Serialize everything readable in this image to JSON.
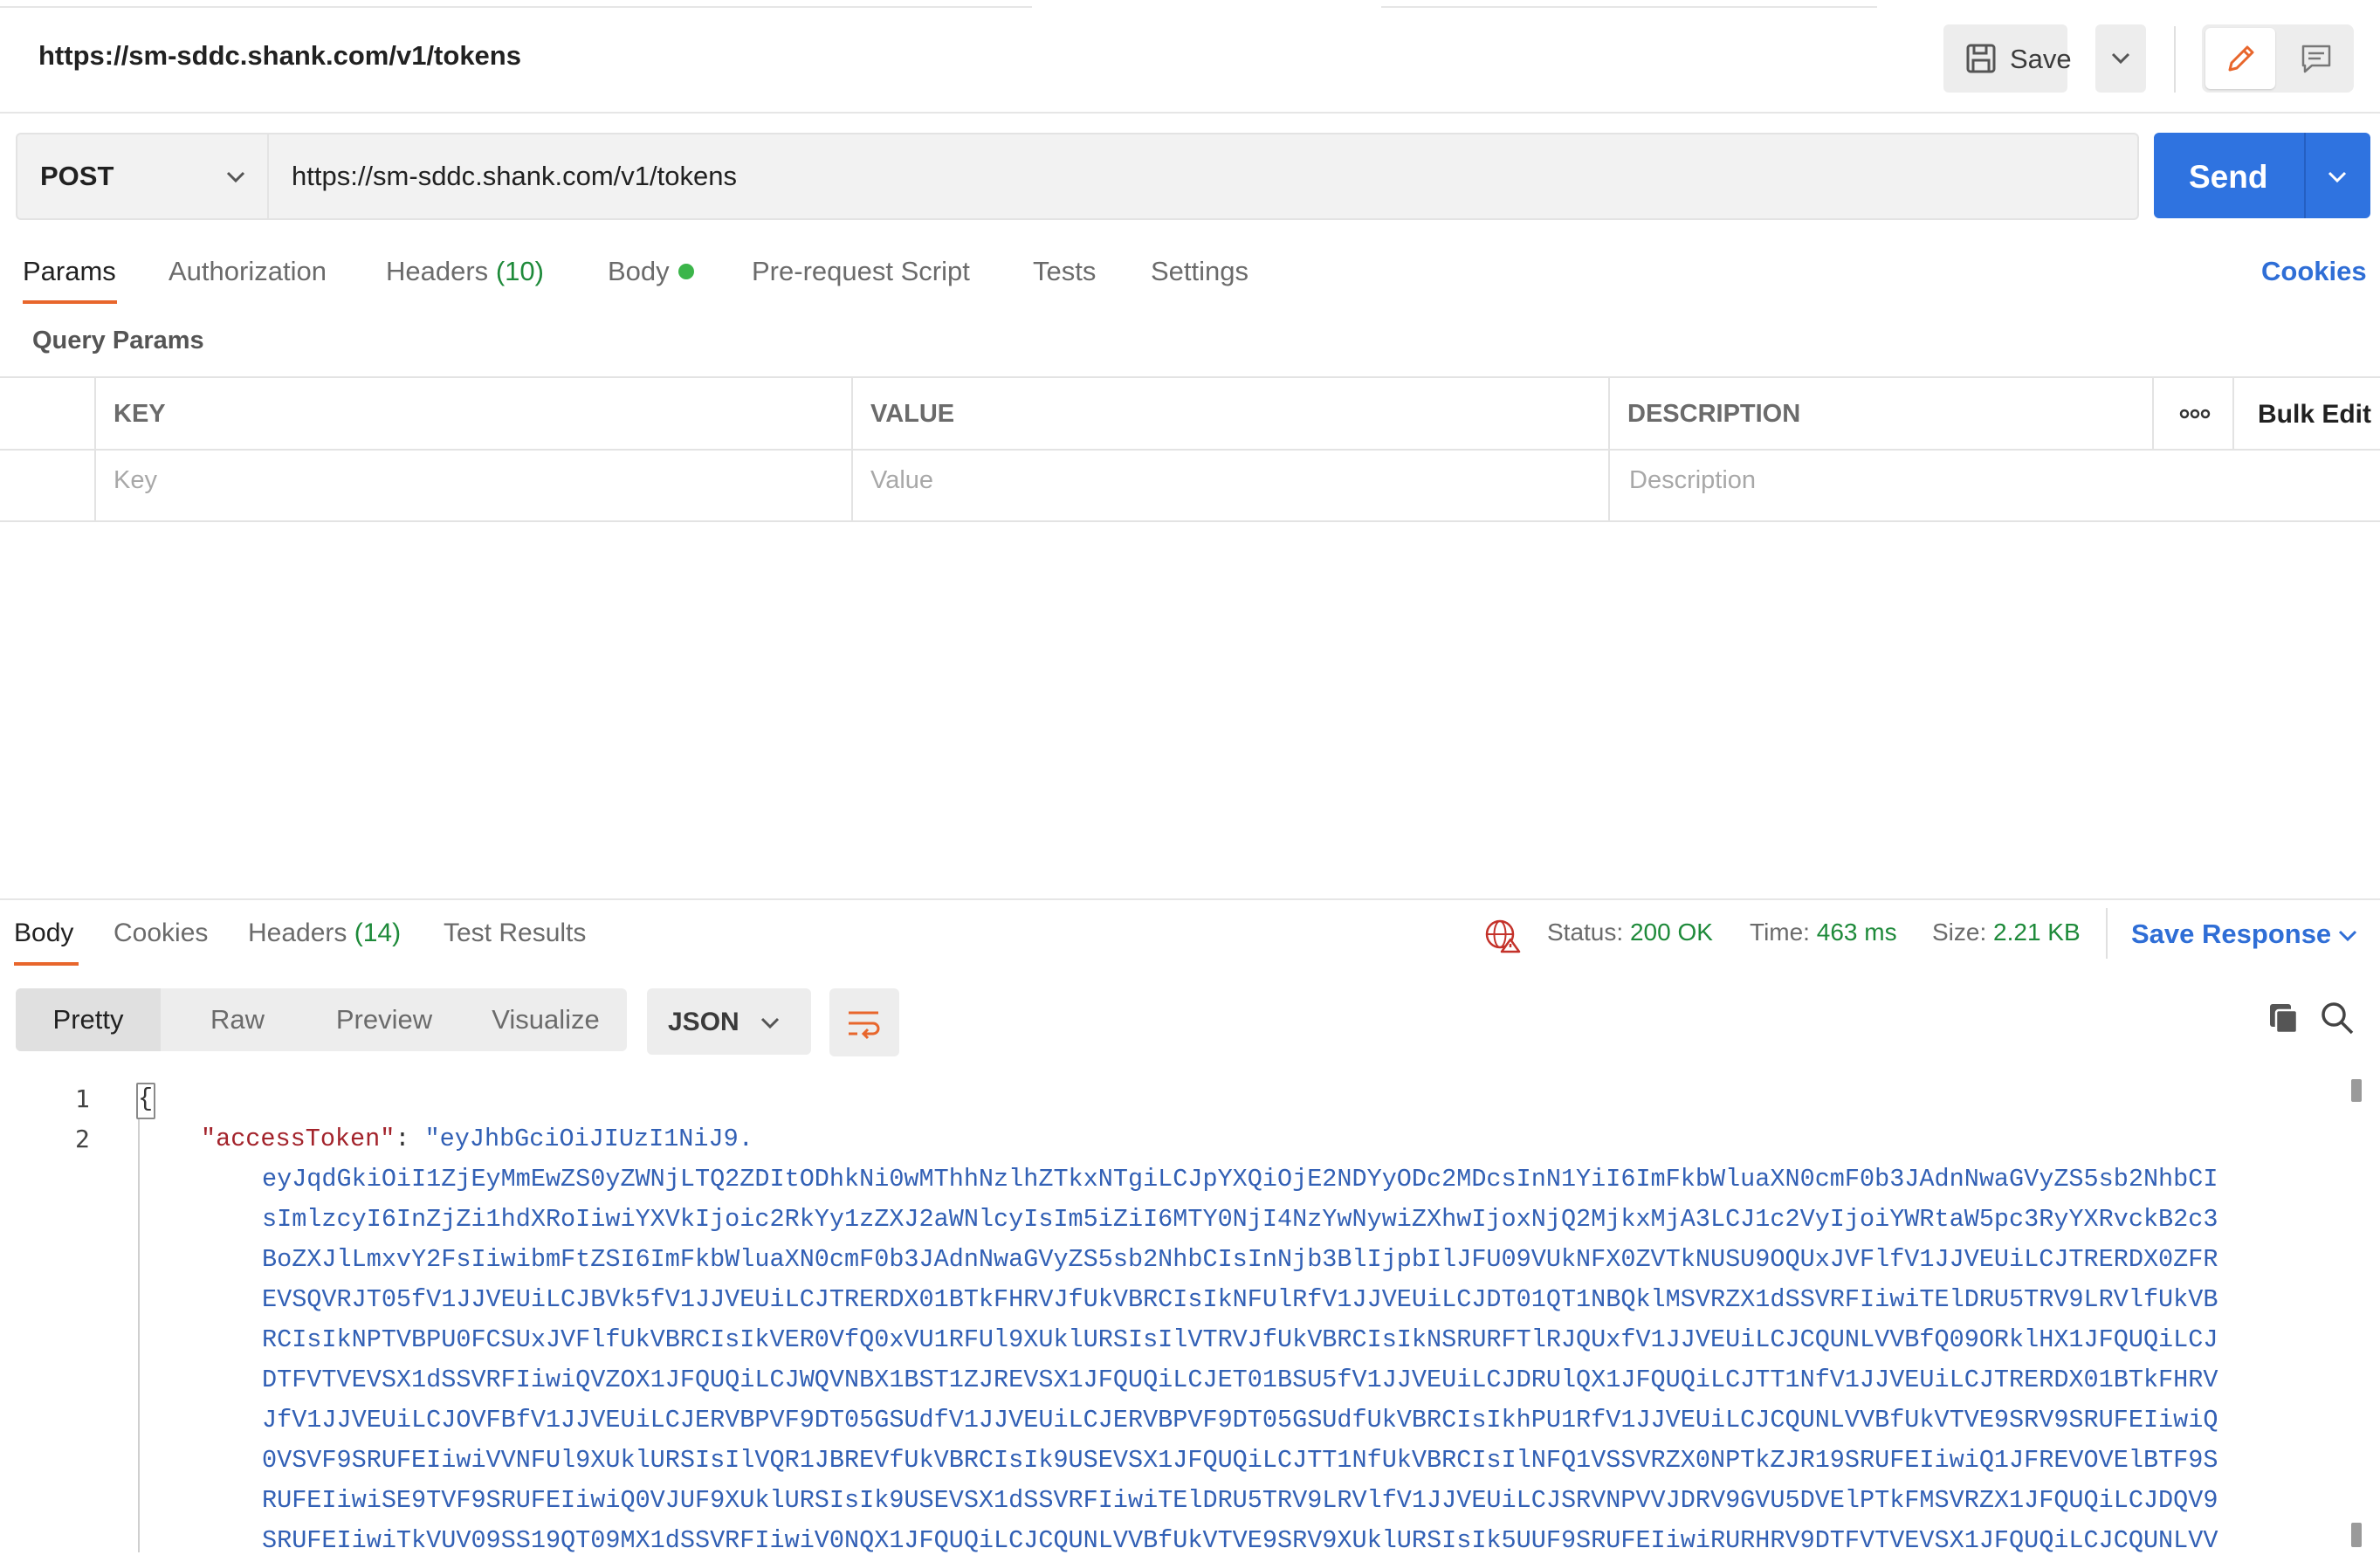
{
  "request": {
    "title": "https://sm-sddc.shank.com/v1/tokens",
    "save_label": "Save",
    "method": "POST",
    "url": "https://sm-sddc.shank.com/v1/tokens",
    "send_label": "Send"
  },
  "request_tabs": {
    "params": "Params",
    "authorization": "Authorization",
    "headers": "Headers",
    "headers_count": "(10)",
    "body": "Body",
    "prerequest": "Pre-request Script",
    "tests": "Tests",
    "settings": "Settings",
    "cookies": "Cookies"
  },
  "query_params": {
    "label": "Query Params",
    "columns": {
      "key": "KEY",
      "value": "VALUE",
      "description": "DESCRIPTION"
    },
    "bulk_edit": "Bulk Edit",
    "placeholders": {
      "key": "Key",
      "value": "Value",
      "description": "Description"
    }
  },
  "response": {
    "tabs": {
      "body": "Body",
      "cookies": "Cookies",
      "headers": "Headers",
      "headers_count": "(14)",
      "test_results": "Test Results"
    },
    "status_label": "Status:",
    "status_value": "200 OK",
    "time_label": "Time:",
    "time_value": "463 ms",
    "size_label": "Size:",
    "size_value": "2.21 KB",
    "save_response": "Save Response",
    "views": [
      "Pretty",
      "Raw",
      "Preview",
      "Visualize"
    ],
    "format": "JSON"
  },
  "editor": {
    "line_numbers": [
      "1",
      "2"
    ],
    "open_brace": "{",
    "key": "\"accessToken\"",
    "colon": ": ",
    "token_lines": [
      "\"eyJhbGciOiJIUzI1NiJ9.",
      "eyJqdGkiOiI1ZjEyMmEwZS0yZWNjLTQ2ZDItODhkNi0wMThhNzlhZTkxNTgiLCJpYXQiOjE2NDYyODc2MDcsInN1YiI6ImFkbWluaXN0cmF0b3JAdnNwaGVyZS5sb2NhbCI",
      "sImlzcyI6InZjZi1hdXRoIiwiYXVkIjoic2RkYy1zZXJ2aWNlcyIsIm5iZiI6MTY0NjI4NzYwNywiZXhwIjoxNjQ2MjkxMjA3LCJ1c2VyIjoiYWRtaW5pc3RyYXRvckB2c3",
      "BoZXJlLmxvY2FsIiwibmFtZSI6ImFkbWluaXN0cmF0b3JAdnNwaGVyZS5sb2NhbCIsInNjb3BlIjpbIlJFU09VUkNFX0ZVTkNUSU9OQUxJVFlfV1JJVEUiLCJTRERDX0ZFR",
      "EVSQVRJT05fV1JJVEUiLCJBVk5fV1JJVEUiLCJTRERDX01BTkFHRVJfUkVBRCIsIkNFUlRfV1JJVEUiLCJDT01QT1NBQklMSVRZX1dSSVRFIiwiTElDRU5TRV9LRVlfUkVB",
      "RCIsIkNPTVBPU0FCSUxJVFlfUkVBRCIsIkVER0VfQ0xVU1RFUl9XUklURSIsIlVTRVJfUkVBRCIsIkNSRURFTlRJQUxfV1JJVEUiLCJCQUNLVVBfQ09ORklHX1JFQUQiLCJ",
      "DTFVTVEVSX1dSSVRFIiwiQVZOX1JFQUQiLCJWQVNBX1BST1ZJREVSX1JFQUQiLCJET01BSU5fV1JJVEUiLCJDRUlQX1JFQUQiLCJTT1NfV1JJVEUiLCJTRERDX01BTkFHRV",
      "JfV1JJVEUiLCJOVFBfV1JJVEUiLCJERVBPVF9DT05GSUdfV1JJVEUiLCJERVBPVF9DT05GSUdfUkVBRCIsIkhPU1RfV1JJVEUiLCJCQUNLVVBfUkVTVE9SRV9SRUFEIiwiQ",
      "0VSVF9SRUFEIiwiVVNFUl9XUklURSIsIlVQR1JBREVfUkVBRCIsIk9USEVSX1JFQUQiLCJTT1NfUkVBRCIsIlNFQ1VSSVRZX0NPTkZJR19SRUFEIiwiQ1JFREVOVElBTF9S",
      "RUFEIiwiSE9TVF9SRUFEIiwiQ0VJUF9XUklURSIsIk9USEVSX1dSSVRFIiwiTElDRU5TRV9LRVlfV1JJVEUiLCJSRVNPVVJDRV9GVU5DVElPTkFMSVRZX1JFQUQiLCJDQV9",
      "SRUFEIiwiTkVUV09SS19QT09MX1dSSVRFIiwiV0NQX1JFQUQiLCJCQUNLVVBfUkVTVE9SRV9XUklURSIsIk5UUF9SRUFEIiwiRURHRV9DTFVTVEVSX1JFQUQiLCJCQUNLVV"
    ]
  }
}
